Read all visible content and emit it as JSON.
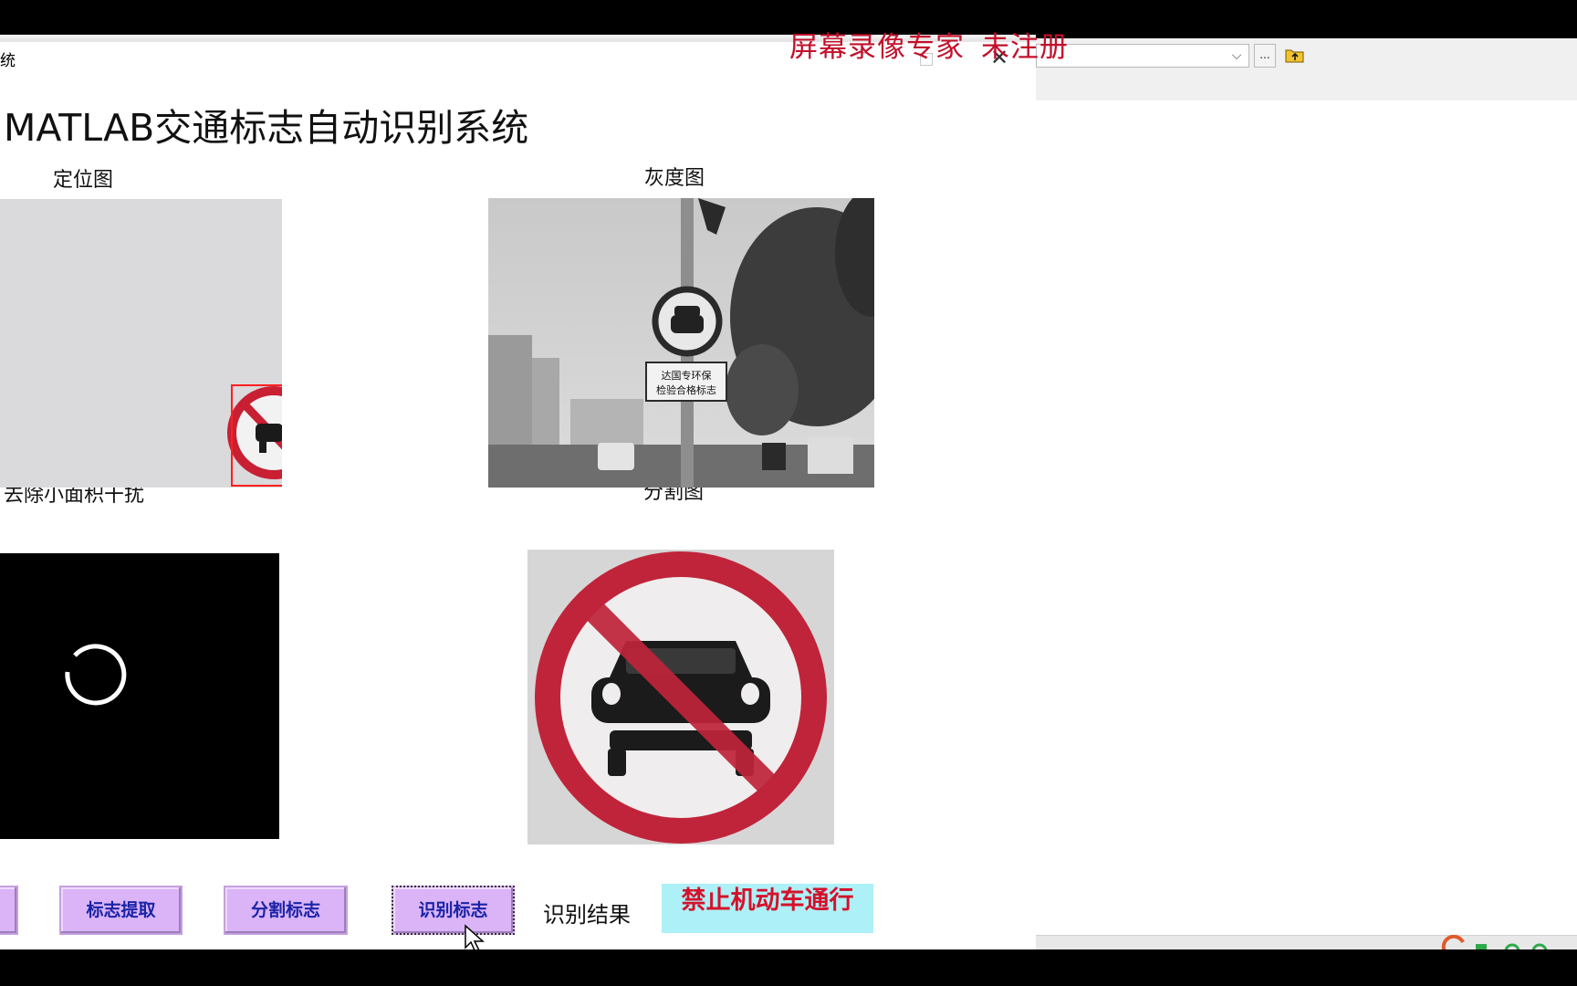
{
  "window": {
    "caption": "统",
    "minimize_glyph": "–",
    "close_glyph": "✕"
  },
  "watermark": {
    "part1": "屏幕录像专家",
    "part2": "未注册"
  },
  "background_app": {
    "dropdown_glyph": "⌵",
    "browse_label": "..."
  },
  "gui": {
    "title": "MATLAB交通标志自动识别系统",
    "axes": {
      "locate": "定位图",
      "gray": "灰度图",
      "denoise": "去除小面积干扰",
      "segment": "分割图"
    },
    "buttons": {
      "extract": "标志提取",
      "segment": "分割标志",
      "recognize": "识别标志"
    },
    "result_label": "识别结果",
    "result_value": "禁止机动车通行",
    "sign_board_text_line1": "达国专环保",
    "sign_board_text_line2": "检验合格标志"
  },
  "colors": {
    "button_bg": "#dab4f6",
    "button_text": "#1a23a8",
    "result_bg": "#aef0f7",
    "result_text": "#d5112b",
    "watermark": "#c2102b",
    "sign_red": "#c0243a"
  },
  "icons": [
    "folder-up-icon",
    "close-icon",
    "minimize-icon",
    "maximize-icon",
    "dropdown-icon",
    "cursor-icon"
  ]
}
